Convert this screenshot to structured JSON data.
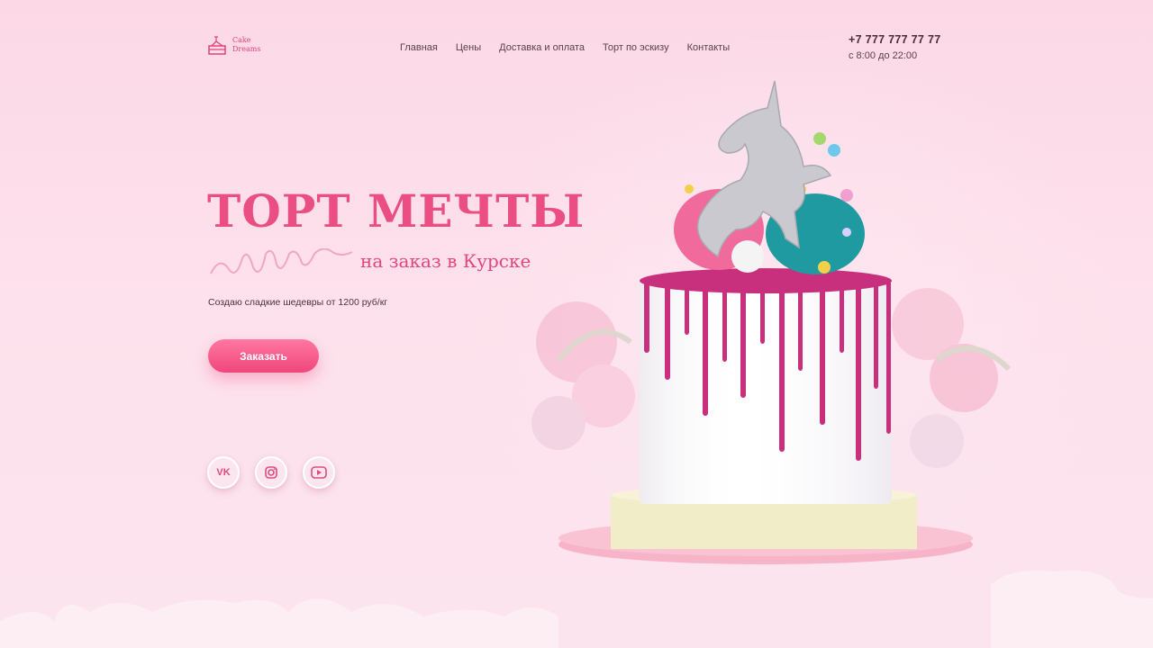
{
  "brand": {
    "name": "Cake\nDreams"
  },
  "nav": {
    "items": [
      "Главная",
      "Цены",
      "Доставка и оплата",
      "Торт по эскизу",
      "Контакты"
    ]
  },
  "contact": {
    "phone": "+7 777 777 77 77",
    "hours": "с 8:00 до 22:00"
  },
  "hero": {
    "title": "ТОРТ МЕЧТЫ",
    "subtitle": "на заказ в Курске",
    "tagline": "Создаю сладкие шедевры от 1200 руб/кг",
    "cta": "Заказать"
  },
  "socials": [
    {
      "icon": "vk-icon"
    },
    {
      "icon": "instagram-icon"
    },
    {
      "icon": "youtube-icon"
    }
  ],
  "colors": {
    "accent": "#eb4e82",
    "background": "#fcd8e6",
    "drip": "#c8307e",
    "teal": "#1f9aa0"
  }
}
